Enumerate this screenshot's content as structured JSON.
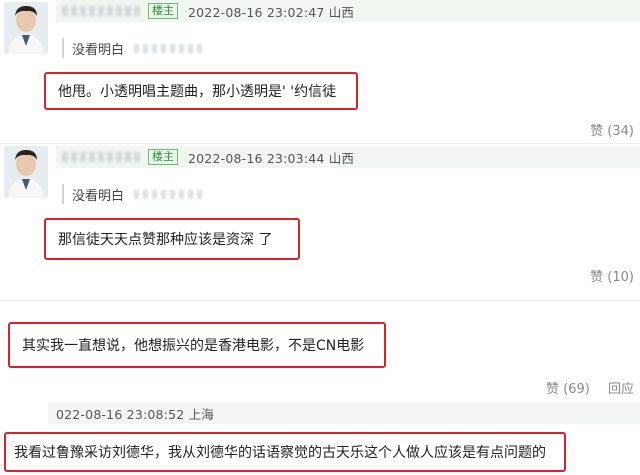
{
  "comments": [
    {
      "badge": "楼主",
      "meta": "2022-08-16 23:02:47 山西",
      "quote_label": "没看明白",
      "text": "他甩。小透明唱主题曲，那小透明是'  '约信徒",
      "likes": "赞 (34)"
    },
    {
      "badge": "楼主",
      "meta": "2022-08-16 23:03:44 山西",
      "quote_label": "没看明白",
      "text": "那信徒天天点赞那种应该是资深  了",
      "likes": "赞 (10)"
    },
    {
      "text": "其实我一直想说，他想振兴的是香港电影，不是CN电影",
      "likes": "赞 (69)",
      "reply": "回应"
    },
    {
      "meta": "022-08-16 23:08:52 上海",
      "text": "我看过鲁豫采访刘德华，我从刘德华的话语察觉的古天乐这个人做人应该是有点问题的"
    }
  ]
}
